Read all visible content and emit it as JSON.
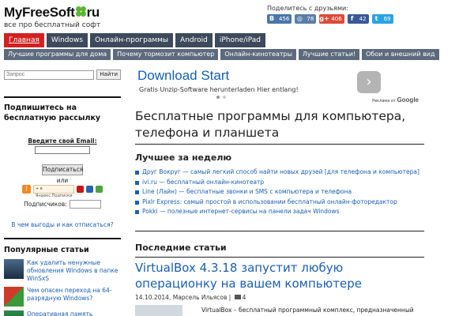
{
  "header": {
    "logo_main": "MyFreeSoft",
    "logo_tld": "ru",
    "tagline": "все про бесплатный софт",
    "share_title": "Поделитесь с друзьями:",
    "share_buttons": [
      {
        "icon": "В",
        "count": "456",
        "color": "#4a76a8",
        "name": "vk"
      },
      {
        "icon": "◎",
        "count": "78",
        "color": "#5a7ea8",
        "name": "mailru"
      },
      {
        "icon": "g+",
        "count": "406",
        "color": "#dd4b39",
        "name": "gplus"
      },
      {
        "icon": "f",
        "count": "42",
        "color": "#3b5998",
        "name": "facebook"
      },
      {
        "icon": "t",
        "count": "69",
        "color": "#2aa3e0",
        "name": "twitter"
      }
    ]
  },
  "nav_main": [
    {
      "label": "Главная",
      "active": true
    },
    {
      "label": "Windows",
      "active": false
    },
    {
      "label": "Онлайн-программы",
      "active": false
    },
    {
      "label": "Android",
      "active": false
    },
    {
      "label": "iPhone/iPad",
      "active": false
    }
  ],
  "nav_sub": [
    "Лучшие программы для дома",
    "Почему тормозит компьютер",
    "Онлайн-кинотеатры",
    "Лучшие статьи!",
    "Обои и внешний вид"
  ],
  "sidebar": {
    "search_placeholder": "Запрос",
    "search_button": "Найти",
    "subscribe_title": "Подпишитесь на бесплатную рассылку",
    "email_label": "Введите свой Email:",
    "subscribe_button": "Подписаться",
    "or_label": "или",
    "subscribers_label": "Подписчиков:",
    "benefit_link": "В чем выгоды и как отписаться?",
    "popular_title": "Популярные статьи",
    "popular": [
      {
        "text": "Как удалить ненужные обновления Windows в папке WinSxS"
      },
      {
        "text": "Чем опасен переход на 64-разрядную Windows?"
      },
      {
        "text": "Оперативная память"
      }
    ]
  },
  "ad": {
    "title": "Download Start",
    "subtitle": "Gratis Unzip-Software herunterladen Hier entlang!",
    "by_label": "Реклама от",
    "by_brand": "Google"
  },
  "main": {
    "title": "Бесплатные программы для компьютера, телефона и планшета",
    "week_title": "Лучшее за неделю",
    "week_items": [
      "Друг Вокруг — самый легкий способ найти новых друзей [для телефона и компьютера]",
      "ivi.ru — бесплатный онлайн-кинотеатр",
      "Line (Лайн) — бесплатные звонки и SMS с компьютера и телефона",
      "Pixlr Express: самый простой в использовании бесплатный онлайн-фоторедактор",
      "Pokki — полезные интернет-сервисы на панели задач Windows"
    ],
    "latest_title": "Последние статьи",
    "article": {
      "title": "VirtualBox 4.3.18 запустит любую операционку на вашем компьютере",
      "date": "14.10.2014",
      "author": "Марсель Ильясов",
      "comments": "4",
      "text": "VirtualBox – бесплатный программный комплекс, предназначенный"
    }
  }
}
